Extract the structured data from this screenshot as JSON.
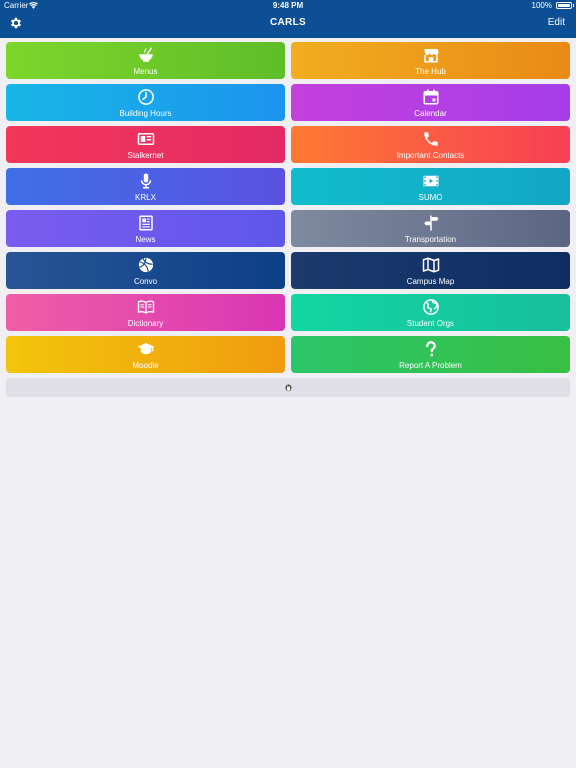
{
  "status_bar": {
    "carrier": "Carrier",
    "time": "9:48 PM",
    "battery": "100%"
  },
  "nav": {
    "title": "CARLS",
    "edit_label": "Edit",
    "settings_icon": "gear-icon"
  },
  "tiles": [
    {
      "label": "Menus",
      "icon": "bowl-icon",
      "colors": [
        "#7dd62b",
        "#5fbd2a"
      ]
    },
    {
      "label": "The Hub",
      "icon": "storefront-icon",
      "colors": [
        "#f1ad1f",
        "#e98a16"
      ]
    },
    {
      "label": "Building Hours",
      "icon": "clock-icon",
      "colors": [
        "#18b6e6",
        "#1c94ee"
      ]
    },
    {
      "label": "Calendar",
      "icon": "calendar-icon",
      "colors": [
        "#c340dc",
        "#a63ee8"
      ]
    },
    {
      "label": "Stalkernet",
      "icon": "id-card-icon",
      "colors": [
        "#f2375a",
        "#e42a64"
      ]
    },
    {
      "label": "Important Contacts",
      "icon": "phone-icon",
      "colors": [
        "#fd7a32",
        "#f83f55"
      ]
    },
    {
      "label": "KRLX",
      "icon": "microphone-icon",
      "colors": [
        "#3f6fe6",
        "#5a52e2"
      ]
    },
    {
      "label": "SUMO",
      "icon": "film-icon",
      "colors": [
        "#12bccb",
        "#13a6c6"
      ]
    },
    {
      "label": "News",
      "icon": "newspaper-icon",
      "colors": [
        "#7a5cf0",
        "#5e57e9"
      ]
    },
    {
      "label": "Transportation",
      "icon": "signpost-icon",
      "colors": [
        "#7f8aa0",
        "#5c6682"
      ]
    },
    {
      "label": "Convo",
      "icon": "basketball-icon",
      "colors": [
        "#275596",
        "#0d3f86"
      ]
    },
    {
      "label": "Campus Map",
      "icon": "map-icon",
      "colors": [
        "#1c3a6c",
        "#0d2d63"
      ]
    },
    {
      "label": "Dictionary",
      "icon": "book-icon",
      "colors": [
        "#f05ea6",
        "#d936b4"
      ]
    },
    {
      "label": "Student Orgs",
      "icon": "globe-icon",
      "colors": [
        "#13d6a2",
        "#17bf9c"
      ]
    },
    {
      "label": "Moodle",
      "icon": "graduation-cap-icon",
      "colors": [
        "#f2c50b",
        "#f09c0f"
      ]
    },
    {
      "label": "Report A Problem",
      "icon": "question-icon",
      "colors": [
        "#2bc66b",
        "#39bf43"
      ]
    }
  ],
  "footer": {
    "icon": "penguin-icon"
  }
}
